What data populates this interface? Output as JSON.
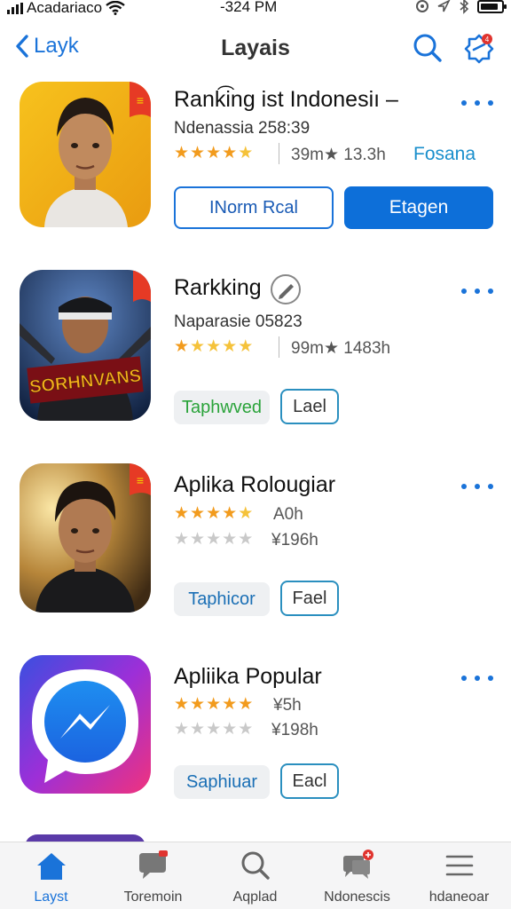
{
  "status_bar": {
    "carrier": "Acadariaco",
    "time": "-324 PM",
    "wifi_icon": "wifi-icon",
    "battery_icon": "battery-icon"
  },
  "nav": {
    "back_label": "Layk",
    "title": "Layais",
    "search_icon": "search-icon",
    "badge_icon": "badge-notification-icon",
    "accent_color": "#1a73d9"
  },
  "apps": [
    {
      "name": "Rank͡ing ist Indonesiı –",
      "subtitle": "Ndenassia 258:39",
      "rating_stars": 5,
      "meta": "39m★ 13.3h",
      "link": "Fosana",
      "btn_outline": "INorm Rcal",
      "btn_primary": "Etagen"
    },
    {
      "name": "Rarkking",
      "subtitle": "Naparasie 05823",
      "rating_stars": 5,
      "meta": "99m★ 1483h",
      "btn_soft": "Taphwved",
      "btn_small": "Lael",
      "icon_text": "SORHNVANS"
    },
    {
      "name": "Aplika Rolougiar",
      "rating_stars": 5,
      "rating_meta": "A0h",
      "rating2_stars": 0,
      "rating2_meta": "¥196h",
      "btn_soft": "Taphicor",
      "btn_small": "Fael"
    },
    {
      "name": "Apliika Popular",
      "rating_stars": 5,
      "rating_meta": "¥5h",
      "rating2_stars": 0,
      "rating2_meta": "¥198h",
      "btn_soft": "Saphiuar",
      "btn_small": "Eacl"
    }
  ],
  "tabs": [
    {
      "label": "Layst",
      "icon": "home-icon",
      "active": true
    },
    {
      "label": "Toremoin",
      "icon": "chat-icon",
      "active": false
    },
    {
      "label": "Aqplad",
      "icon": "search-icon",
      "active": false
    },
    {
      "label": "Ndonescis",
      "icon": "messages-icon",
      "active": false
    },
    {
      "label": "hdaneoar",
      "icon": "menu-icon",
      "active": false
    }
  ]
}
